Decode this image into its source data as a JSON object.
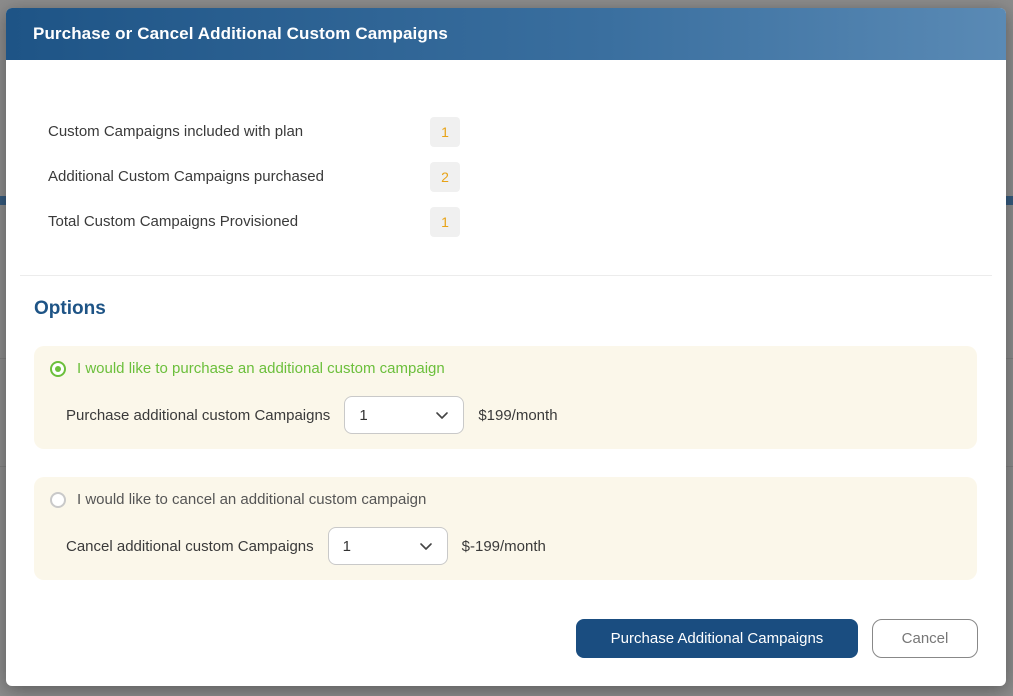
{
  "modal": {
    "title": "Purchase or Cancel Additional Custom Campaigns"
  },
  "summary": [
    {
      "label": "Custom Campaigns included with plan",
      "value": "1"
    },
    {
      "label": "Additional Custom Campaigns purchased",
      "value": "2"
    },
    {
      "label": "Total Custom Campaigns Provisioned",
      "value": "1"
    }
  ],
  "options": {
    "title": "Options",
    "purchase": {
      "radio_label": "I would like to purchase an additional custom campaign",
      "selected": true,
      "field_label": "Purchase additional custom Campaigns",
      "quantity": "1",
      "price": "$199/month"
    },
    "cancel": {
      "radio_label": "I would like to cancel an additional custom campaign",
      "selected": false,
      "field_label": "Cancel additional custom Campaigns",
      "quantity": "1",
      "price": "$-199/month"
    }
  },
  "buttons": {
    "primary": "Purchase Additional Campaigns",
    "cancel": "Cancel"
  },
  "colors": {
    "header": "#1e5486",
    "accent_green": "#6bbf3b",
    "badge_text": "#e8a317",
    "primary_button": "#1a4d80",
    "option_card_bg": "#fbf7ea"
  },
  "icons": {
    "select_arrow": "chevron-down-icon",
    "radio": "radio-icon"
  }
}
